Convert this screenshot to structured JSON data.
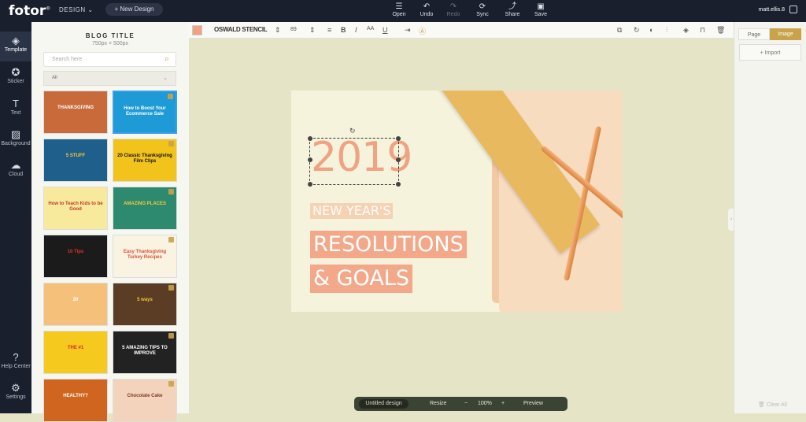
{
  "app": {
    "logo": "fotor",
    "design_menu": "DESIGN",
    "new_design": "+ New Design",
    "user": "matt.ellis.8"
  },
  "toolbar": [
    {
      "label": "Open",
      "icon": "open-icon",
      "enabled": true
    },
    {
      "label": "Undo",
      "icon": "undo-icon",
      "enabled": true
    },
    {
      "label": "Redo",
      "icon": "redo-icon",
      "enabled": false
    },
    {
      "label": "Sync",
      "icon": "sync-icon",
      "enabled": true
    },
    {
      "label": "Share",
      "icon": "share-icon",
      "enabled": true
    },
    {
      "label": "Save",
      "icon": "save-icon",
      "enabled": true
    }
  ],
  "sidebar": {
    "items": [
      {
        "label": "Template",
        "icon": "template-icon"
      },
      {
        "label": "Sticker",
        "icon": "sticker-icon"
      },
      {
        "label": "Text",
        "icon": "text-icon"
      },
      {
        "label": "Background",
        "icon": "background-icon"
      },
      {
        "label": "Cloud",
        "icon": "cloud-icon"
      }
    ],
    "help": "Help Center",
    "settings": "Settings"
  },
  "panel": {
    "title": "BLOG TITLE",
    "size": "750px × 500px",
    "search_placeholder": "Search here",
    "filter": "All",
    "thumbs": [
      {
        "text": "THANKSGIVING",
        "bg": "#c86a3a",
        "fg": "#fff"
      },
      {
        "text": "How to Boost Your Ecommerce Sale",
        "bg": "#1e9ad6",
        "fg": "#fff"
      },
      {
        "text": "5 STUFF",
        "bg": "#1f5f8b",
        "fg": "#f5c542"
      },
      {
        "text": "20 Classic Thanksgiving Film Clips",
        "bg": "#f2c31a",
        "fg": "#111"
      },
      {
        "text": "How to Teach Kids to be Good",
        "bg": "#f7ea9c",
        "fg": "#c23b2c"
      },
      {
        "text": "AMAZING PLACES",
        "bg": "#2e8a6e",
        "fg": "#f5c542"
      },
      {
        "text": "10 Tips",
        "bg": "#1b1b1b",
        "fg": "#e0332a"
      },
      {
        "text": "Easy Thanksgiving Turkey Recipes",
        "bg": "#fbf3e2",
        "fg": "#d6513a"
      },
      {
        "text": "20",
        "bg": "#f5c07a",
        "fg": "#fff"
      },
      {
        "text": "5 ways",
        "bg": "#5a3d24",
        "fg": "#f5c542"
      },
      {
        "text": "THE #1",
        "bg": "#f5c91e",
        "fg": "#d12a2a"
      },
      {
        "text": "5 AMAZING TIPS TO IMPROVE",
        "bg": "#222",
        "fg": "#fff"
      },
      {
        "text": "HEALTHY?",
        "bg": "#d0651f",
        "fg": "#fff"
      },
      {
        "text": "Chocolate Cake",
        "bg": "#f3d3bb",
        "fg": "#7a3b22"
      }
    ]
  },
  "text_toolbar": {
    "font": "OSWALD STENCIL",
    "size": "89",
    "color": "#f0a283"
  },
  "canvas": {
    "year": "2019",
    "line1": "NEW YEAR'S",
    "line2": "RESOLUTIONS",
    "line3": "& GOALS"
  },
  "right_panel": {
    "tab_page": "Page",
    "tab_image": "Image",
    "import": "+ Import",
    "clear": "Clear All"
  },
  "bottom": {
    "design_name": "Untitled design",
    "resize": "Resize",
    "zoom": "100%",
    "preview": "Preview",
    "minus": "−",
    "plus": "+"
  }
}
